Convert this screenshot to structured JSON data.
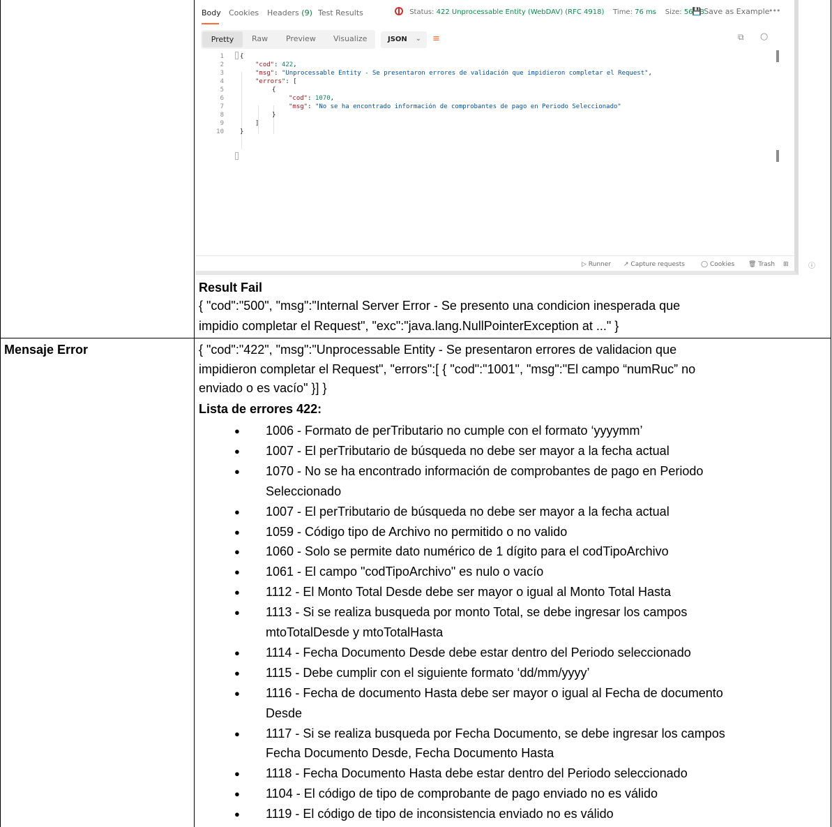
{
  "postman": {
    "tabs": [
      {
        "label": "Body",
        "active": true
      },
      {
        "label": "Cookies",
        "active": false
      },
      {
        "label": "Headers",
        "count": "(9)",
        "active": false
      },
      {
        "label": "Test Results",
        "active": false
      }
    ],
    "status_label": "Status:",
    "status_value": "422 Unprocessable Entity (WebDAV) (RFC 4918)",
    "time_label": "Time:",
    "time_value": "76 ms",
    "size_label": "Size:",
    "size_value": "567 B",
    "save_label": "Save as Example",
    "view_modes": [
      "Pretty",
      "Raw",
      "Preview",
      "Visualize"
    ],
    "format": "JSON",
    "code_lines": [
      {
        "n": "1",
        "text": "{"
      },
      {
        "n": "2",
        "key": "\"cod\"",
        "rest": ": ",
        "val": "422",
        "tail": ","
      },
      {
        "n": "3",
        "key": "\"msg\"",
        "rest": ": ",
        "str": "\"Unprocessable Entity - Se presentaron errores de validación que impidieron completar el Request\"",
        "tail": ","
      },
      {
        "n": "4",
        "key": "\"errors\"",
        "rest": ": ["
      },
      {
        "n": "5",
        "text": "{"
      },
      {
        "n": "6",
        "key": "\"cod\"",
        "rest": ": ",
        "val": "1070",
        "tail": ","
      },
      {
        "n": "7",
        "key": "\"msg\"",
        "rest": ": ",
        "str": "\"No se ha encontrado información de comprobantes de pago en Periodo Seleccionado\""
      },
      {
        "n": "8",
        "text": "}"
      },
      {
        "n": "9",
        "text": "]"
      },
      {
        "n": "10",
        "text": "}"
      }
    ],
    "footer": [
      "Runner",
      "Capture requests",
      "Cookies",
      "Trash"
    ]
  },
  "result_fail": {
    "title": "Result Fail",
    "line1": "{ \"cod\":\"500\", \"msg\":\"Internal Server Error - Se presento una condicion inesperada que",
    "line2": "impidio completar el Request\", \"exc\":\"java.lang.NullPointerException at ...\" }"
  },
  "mensaje_error": {
    "label": "Mensaje Error",
    "line1": "{ \"cod\":\"422\", \"msg\":\"Unprocessable Entity - Se presentaron errores de validacion que",
    "line2": "impidieron completar el Request\", \"errors\":[ { \"cod\":\"1001\", \"msg\":\"El campo “numRuc” no",
    "line3": "enviado o es vacío\" }] }",
    "list_title": "Lista de errores 422:",
    "errors": [
      [
        "1006 - Formato de perTributario no cumple con el formato ‘yyyymm’"
      ],
      [
        "1007 - El perTributario de búsqueda no debe ser mayor a la fecha actual"
      ],
      [
        "1070 - No se ha encontrado información de comprobantes de pago en Periodo",
        "Seleccionado"
      ],
      [
        "1007 - El perTributario de búsqueda no debe ser mayor a la fecha actual"
      ],
      [
        "1059 - Código tipo de Archivo no permitido o no valido"
      ],
      [
        "1060 - Solo se permite dato numérico de 1 dígito para el codTipoArchivo"
      ],
      [
        "1061 - El campo \"codTipoArchivo\" es nulo o vacío"
      ],
      [
        "1112 - El Monto Total Desde debe ser mayor o igual al Monto Total Hasta"
      ],
      [
        "1113 - Si se realiza busqueda por monto Total, se debe ingresar los campos",
        "mtoTotalDesde y mtoTotalHasta"
      ],
      [
        "1114 - Fecha Documento Desde debe estar dentro del Periodo seleccionado"
      ],
      [
        "1115 - Debe cumplir con el siguiente formato ‘dd/mm/yyyy’"
      ],
      [
        "1116 - Fecha de documento Hasta debe ser mayor o igual al Fecha de documento",
        "Desde"
      ],
      [
        "1117 - Si se realiza busqueda por Fecha Documento, se debe ingresar los campos",
        "Fecha Documento Desde, Fecha Documento Hasta"
      ],
      [
        "1118 - Fecha Documento Hasta debe estar dentro del Periodo seleccionado"
      ],
      [
        "1104 - El código de tipo de comprobante de pago enviado no es válido"
      ],
      [
        "1119 - El código de tipo de inconsistencia enviado no es válido"
      ]
    ]
  }
}
